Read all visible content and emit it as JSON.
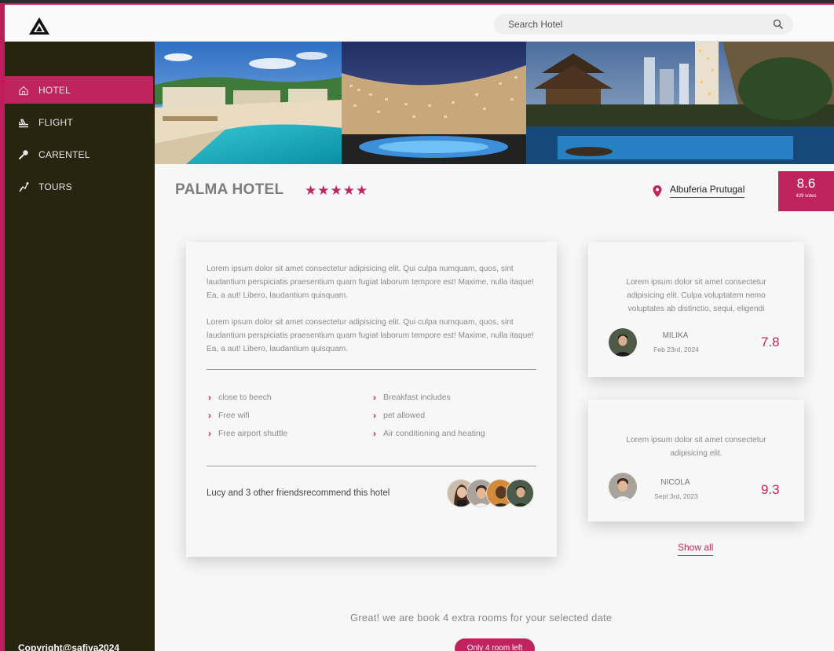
{
  "header": {
    "logo_name": "triangle-logo",
    "search": {
      "placeholder": "Search Hotel"
    }
  },
  "sidebar": {
    "items": [
      {
        "label": "HOTEL",
        "icon": "home-icon",
        "active": true
      },
      {
        "label": "FLIGHT",
        "icon": "plane-icon",
        "active": false
      },
      {
        "label": "CARENTEL",
        "icon": "key-icon",
        "active": false
      },
      {
        "label": "TOURS",
        "icon": "tours-icon",
        "active": false
      }
    ],
    "copyright": "Copyright@safiya2024"
  },
  "hotel": {
    "name": "PALMA HOTEL",
    "stars": "★★★★★",
    "location": "Albuferia Prutugal",
    "score": "8.6",
    "votes": "429 votes"
  },
  "description": {
    "paragraph1": "Lorem ipsum dolor sit amet consectetur adipisicing elit. Qui culpa numquam, quos, sint laudantium perspiciatis praesentium quam fugiat laborum tempore est! Maxime, nulla itaque! Ea, a aut! Libero, laudantium quisquam.",
    "paragraph2": "Lorem ipsum dolor sit amet consectetur adipisicing elit. Qui culpa numquam, quos, sint laudantium perspiciatis praesentium quam fugiat laborum tempore est! Maxime, nulla itaque! Ea, a aut! Libero, laudantium quisquam."
  },
  "amenities": [
    "close to beech",
    "Free wifi",
    "Free airport shuttle",
    "Breakfast includes",
    "pet allowed",
    "Air conditioning and heating"
  ],
  "recommend": {
    "text": "Lucy and 3 other friendsrecommend this hotel"
  },
  "reviews": [
    {
      "text": "Lorem ipsum dolor sit amet consectetur adipisicing elit. Culpa voluptatem nemo voluptates ab distinctio, sequi, eligendi",
      "name": "MILIKA",
      "date": "Feb 23rd, 2024",
      "score": "7.8"
    },
    {
      "text": "Lorem ipsum dolor sit amet consectetur adipisicing elit.",
      "name": "NICOLA",
      "date": "Sept 3rd, 2023",
      "score": "9.3"
    }
  ],
  "show_all": "Show all",
  "booking": {
    "message": "Great! we are book 4 extra rooms for your selected date",
    "badge": "Only 4 room left"
  },
  "colors": {
    "accent": "#c0245e",
    "sidebar_bg": "#27250f",
    "page_bg": "#f7f7f7"
  }
}
